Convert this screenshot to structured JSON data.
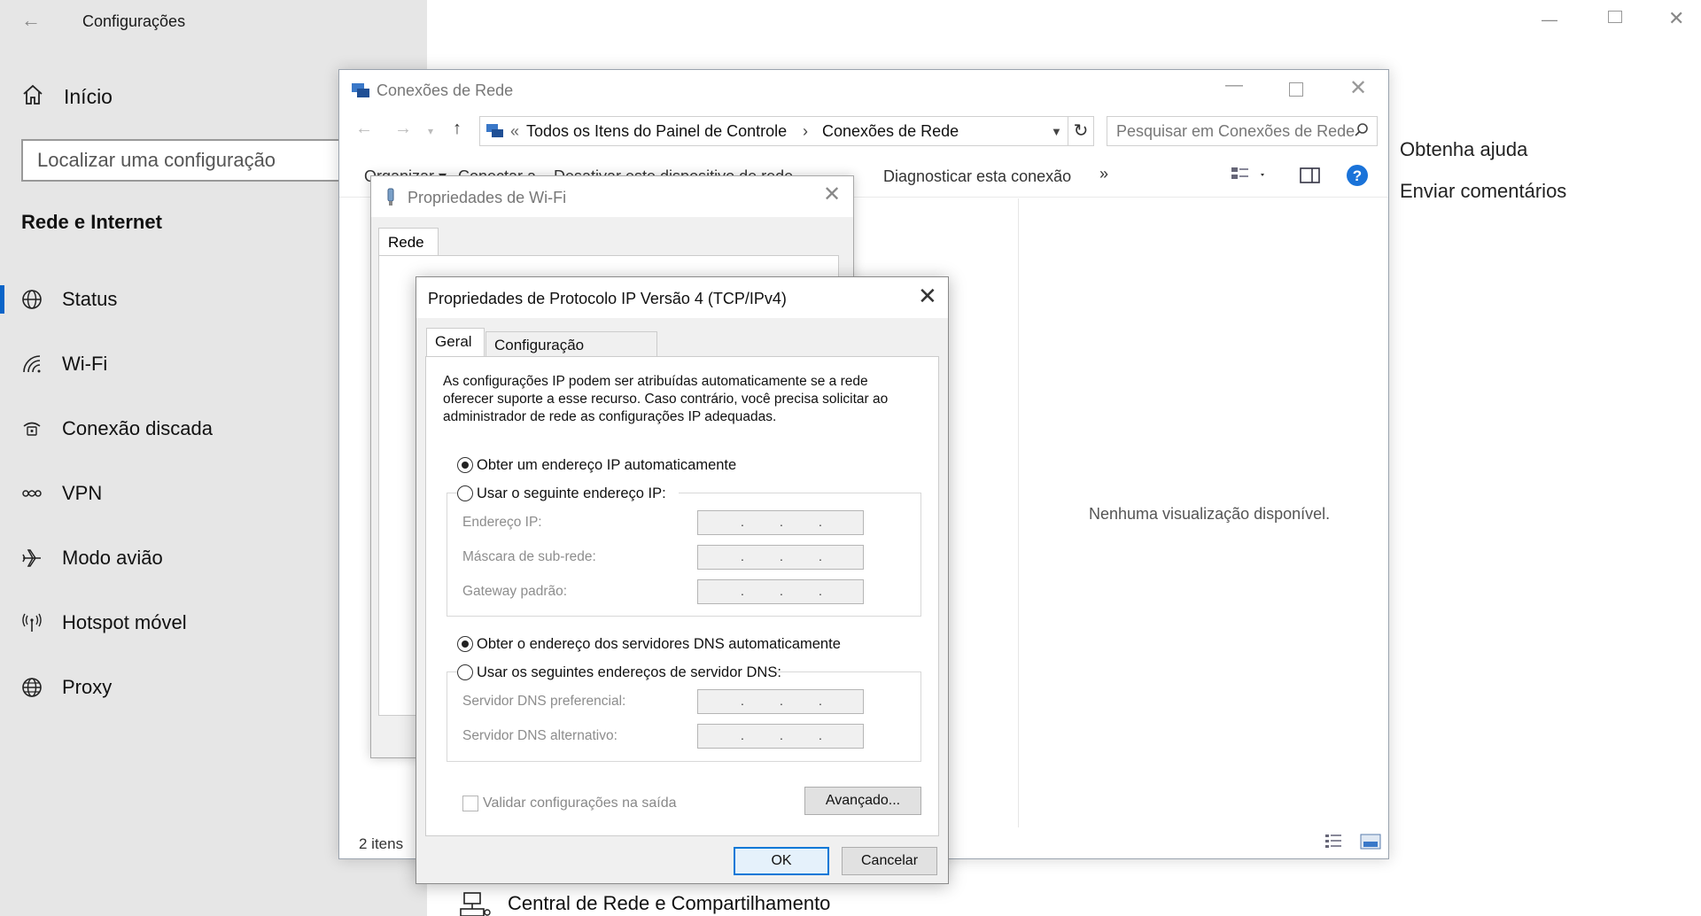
{
  "settings": {
    "title": "Configurações",
    "home_label": "Início",
    "search_placeholder": "Localizar uma configuração",
    "section_title": "Rede e Internet",
    "nav": [
      {
        "label": "Status",
        "icon": "globe-icon",
        "active": true
      },
      {
        "label": "Wi-Fi",
        "icon": "wifi-icon"
      },
      {
        "label": "Conexão discada",
        "icon": "dialup-icon"
      },
      {
        "label": "VPN",
        "icon": "vpn-icon"
      },
      {
        "label": "Modo avião",
        "icon": "airplane-icon"
      },
      {
        "label": "Hotspot móvel",
        "icon": "hotspot-icon"
      },
      {
        "label": "Proxy",
        "icon": "globe-icon"
      }
    ],
    "help_link": "Obtenha ajuda",
    "feedback_link": "Enviar comentários",
    "central_link": "Central de Rede e Compartilhamento"
  },
  "explorer": {
    "title": "Conexões de Rede",
    "breadcrumb_root": "Todos os Itens do Painel de Controle",
    "breadcrumb_current": "Conexões de Rede",
    "search_placeholder": "Pesquisar em Conexões de Rede",
    "commands": {
      "organize": "Organizar ▾",
      "connect": "Conectar a",
      "disable": "Desativar este dispositivo de rede",
      "diagnose": "Diagnosticar esta conexão",
      "more": "»"
    },
    "preview_message": "Nenhuma visualização disponível.",
    "item_count": "2 itens"
  },
  "wifi_dialog": {
    "title": "Propriedades de Wi-Fi",
    "tab": "Rede"
  },
  "ipv4_dialog": {
    "title": "Propriedades de Protocolo IP Versão 4 (TCP/IPv4)",
    "tab_general": "Geral",
    "tab_alternate": "Configuração alternativa",
    "description": "As configurações IP podem ser atribuídas automaticamente se a rede oferecer suporte a esse recurso. Caso contrário, você precisa solicitar ao administrador de rede as configurações IP adequadas.",
    "radio_ip_auto": "Obter um endereço IP automaticamente",
    "radio_ip_manual": "Usar o seguinte endereço IP:",
    "ip_address_label": "Endereço IP:",
    "subnet_label": "Máscara de sub-rede:",
    "gateway_label": "Gateway padrão:",
    "radio_dns_auto": "Obter o endereço dos servidores DNS automaticamente",
    "radio_dns_manual": "Usar os seguintes endereços de servidor DNS:",
    "dns_preferred_label": "Servidor DNS preferencial:",
    "dns_alternate_label": "Servidor DNS alternativo:",
    "validate_label": "Validar configurações na saída",
    "advanced_button": "Avançado...",
    "ok_button": "OK",
    "cancel_button": "Cancelar",
    "ip_auto_selected": true,
    "dns_auto_selected": true
  },
  "colors": {
    "accent": "#0078d7",
    "settings_bg": "#e6e6e6",
    "active_indicator": "#0a64c8"
  }
}
